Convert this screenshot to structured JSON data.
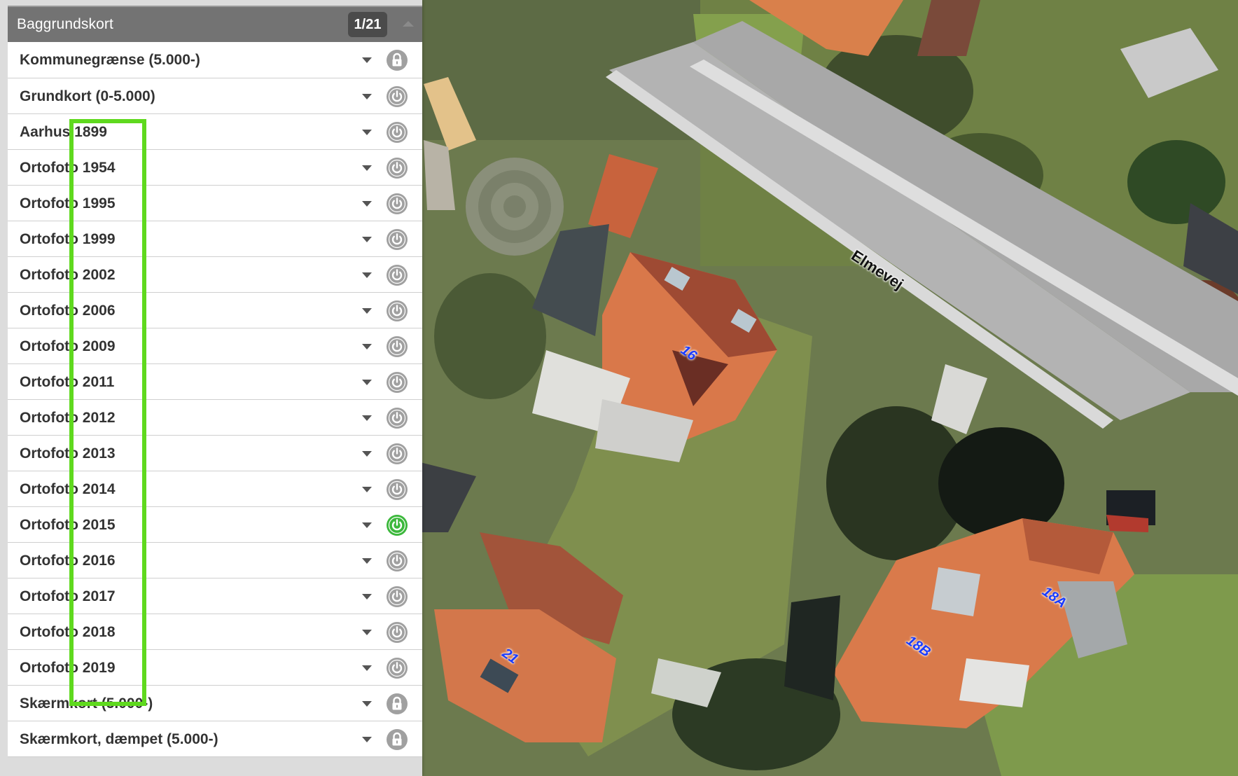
{
  "panel": {
    "title": "Baggrundskort",
    "page_counter": "1/21",
    "layers": [
      {
        "label": "Kommunegrænse (5.000-)",
        "state": "locked"
      },
      {
        "label": "Grundkort (0-5.000)",
        "state": "off"
      },
      {
        "label": "Aarhus 1899",
        "state": "off"
      },
      {
        "label": "Ortofoto 1954",
        "state": "off"
      },
      {
        "label": "Ortofoto 1995",
        "state": "off"
      },
      {
        "label": "Ortofoto 1999",
        "state": "off"
      },
      {
        "label": "Ortofoto 2002",
        "state": "off"
      },
      {
        "label": "Ortofoto 2006",
        "state": "off"
      },
      {
        "label": "Ortofoto 2009",
        "state": "off"
      },
      {
        "label": "Ortofoto 2011",
        "state": "off"
      },
      {
        "label": "Ortofoto 2012",
        "state": "off"
      },
      {
        "label": "Ortofoto 2013",
        "state": "off"
      },
      {
        "label": "Ortofoto 2014",
        "state": "off"
      },
      {
        "label": "Ortofoto 2015",
        "state": "on"
      },
      {
        "label": "Ortofoto 2016",
        "state": "off"
      },
      {
        "label": "Ortofoto 2017",
        "state": "off"
      },
      {
        "label": "Ortofoto 2018",
        "state": "off"
      },
      {
        "label": "Ortofoto 2019",
        "state": "off"
      },
      {
        "label": "Skærmkort (5.000-)",
        "state": "locked"
      },
      {
        "label": "Skærmkort, dæmpet (5.000-)",
        "state": "locked"
      }
    ]
  },
  "map": {
    "street_name": "Elmevej",
    "house_numbers": [
      "16",
      "21",
      "18B",
      "18A"
    ]
  },
  "colors": {
    "header": "#737373",
    "counter_bg": "#4b4b4b",
    "active_toggle": "#3cb83c",
    "inactive_toggle": "#a0a0a0",
    "highlight": "#5fd91e",
    "house_number": "#1a3cff"
  },
  "icons": {
    "locked": "lock-icon",
    "off": "power-icon",
    "on": "power-icon-active",
    "dropdown": "caret-down-icon",
    "collapse": "caret-up-icon"
  }
}
